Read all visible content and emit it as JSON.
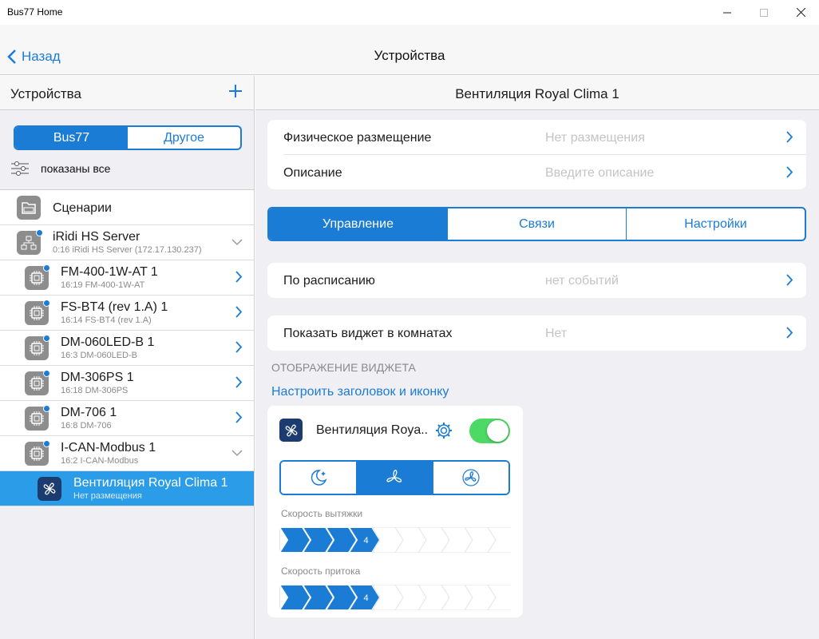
{
  "window": {
    "title": "Bus77 Home"
  },
  "nav": {
    "back_label": "Назад",
    "title": "Устройства"
  },
  "left": {
    "header": "Устройства",
    "segment": [
      "Bus77",
      "Другое"
    ],
    "filter_label": "показаны все",
    "items": [
      {
        "name": "Сценарии",
        "sub": ""
      },
      {
        "name": "iRidi HS Server",
        "sub": "0:16 iRidi HS Server (172.17.130.237)"
      },
      {
        "name": "FM-400-1W-AT 1",
        "sub": "16:19 FM-400-1W-AT"
      },
      {
        "name": "FS-BT4 (rev 1.A) 1",
        "sub": "16:14 FS-BT4 (rev 1.A)"
      },
      {
        "name": "DM-060LED-B 1",
        "sub": "16:3 DM-060LED-B"
      },
      {
        "name": "DM-306PS 1",
        "sub": "16:18 DM-306PS"
      },
      {
        "name": "DM-706 1",
        "sub": "16:8 DM-706"
      },
      {
        "name": "I-CAN-Modbus 1",
        "sub": "16:2 I-CAN-Modbus"
      },
      {
        "name": "Вентиляция Royal Clima 1",
        "sub": "Нет размещения"
      }
    ]
  },
  "right": {
    "header": "Вентиляция Royal Clima 1",
    "placement_label": "Физическое размещение",
    "placement_value": "Нет размещения",
    "description_label": "Описание",
    "description_placeholder": "Введите описание",
    "tabs": [
      "Управление",
      "Связи",
      "Настройки"
    ],
    "schedule_label": "По расписанию",
    "schedule_value": "нет событий",
    "show_widget_label": "Показать виджет в комнатах",
    "show_widget_value": "Нет",
    "section_label": "ОТОБРАЖЕНИЕ ВИДЖЕТА",
    "config_link": "Настроить заголовок и иконку",
    "widget": {
      "title": "Вентиляция Roya..",
      "enabled": true,
      "mode_icons": [
        "night-mode-icon",
        "fan-icon",
        "fan-turbo-icon"
      ],
      "active_mode": 1,
      "exhaust_label": "Скорость вытяжки",
      "exhaust_value": "4",
      "supply_label": "Скорость притока",
      "supply_value": "4",
      "speed_max": 10
    }
  },
  "colors": {
    "accent": "#1b7cd6",
    "selected": "#2b9de8",
    "toggle_on": "#4cd964"
  }
}
